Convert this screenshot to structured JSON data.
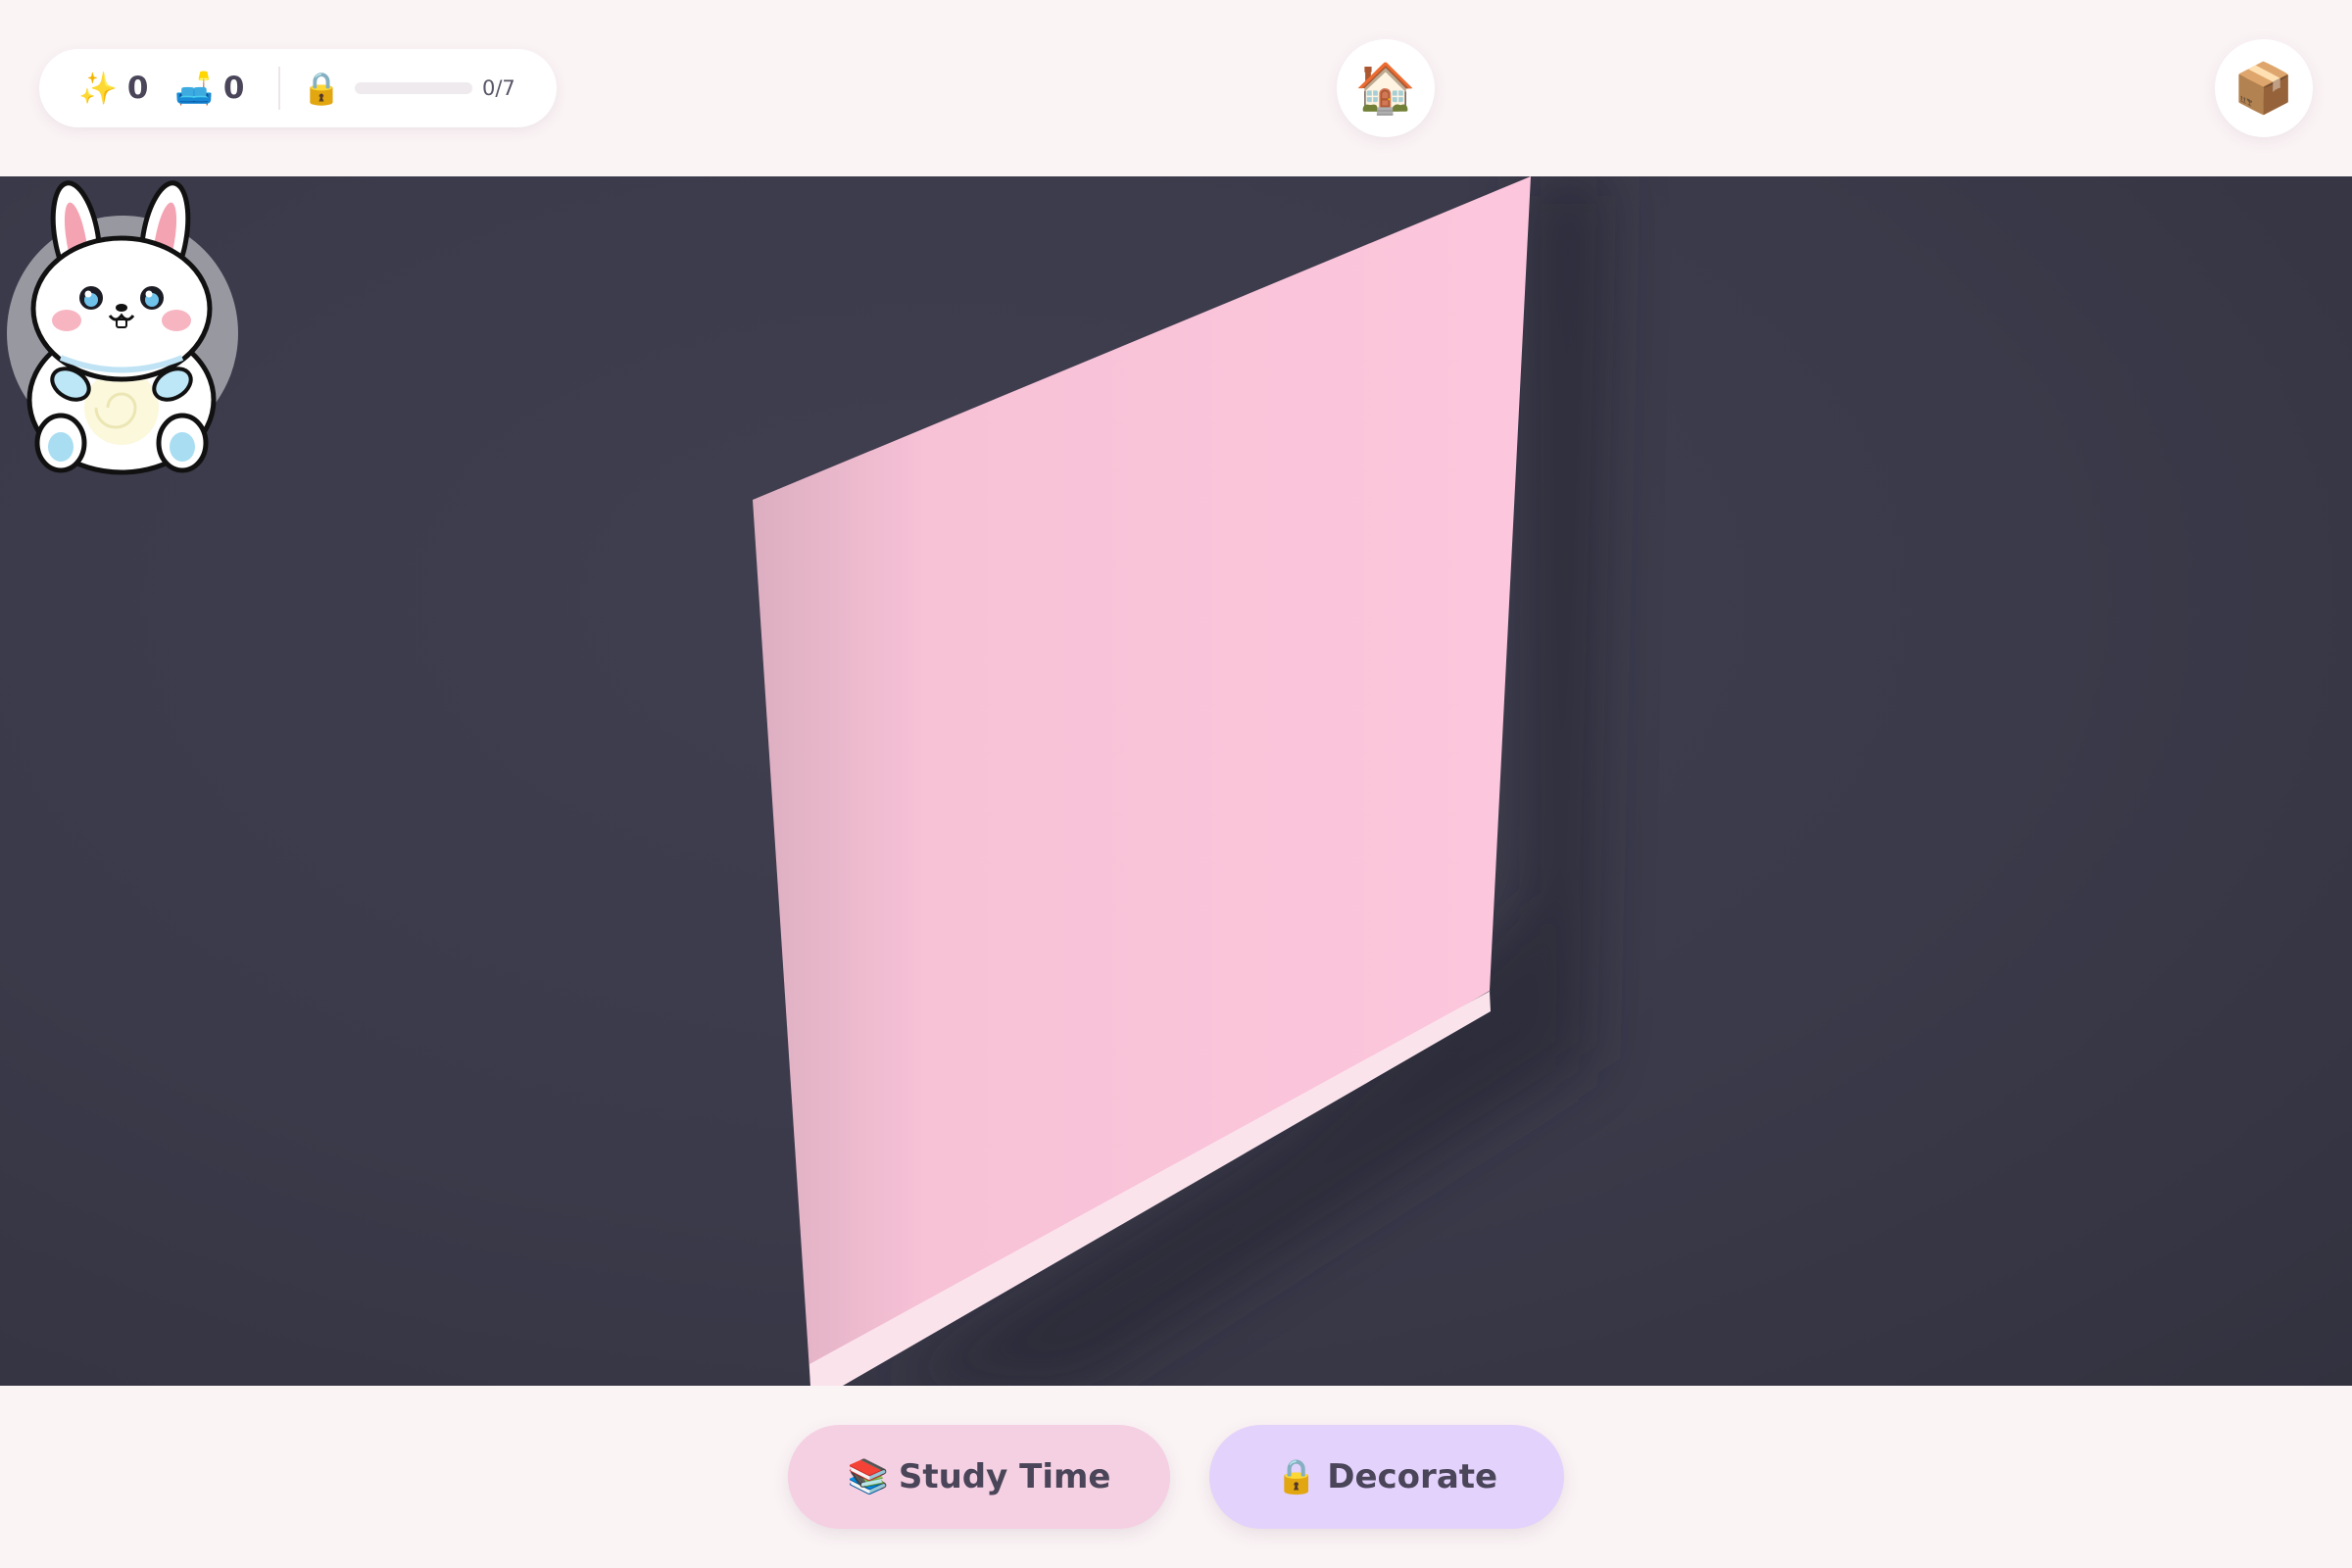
{
  "topbar": {
    "sparkles": {
      "icon": "sparkles-icon",
      "glyph": "✨",
      "count": "0"
    },
    "furniture": {
      "icon": "couch-icon",
      "glyph": "🛋️",
      "count": "0"
    },
    "lock": {
      "icon": "lock-icon",
      "glyph": "🔒"
    },
    "progress": {
      "current": 0,
      "total": 7,
      "label": "0/7"
    },
    "home_button": {
      "icon": "house-icon",
      "glyph": "🏠"
    },
    "inventory_button": {
      "icon": "package-icon",
      "glyph": "📦"
    }
  },
  "scene": {
    "background": "#3a3a4a",
    "wall_color": "#fac4da",
    "floor_strip_color": "#fbe6ee"
  },
  "mascot": {
    "icon": "bunny-icon"
  },
  "actions": {
    "study": {
      "icon": "books-icon",
      "glyph": "📚",
      "label": "Study Time",
      "color": "#f5cfe2"
    },
    "decorate": {
      "icon": "lock-icon",
      "glyph": "🔒",
      "label": "Decorate",
      "color": "#e3d2fb"
    }
  }
}
